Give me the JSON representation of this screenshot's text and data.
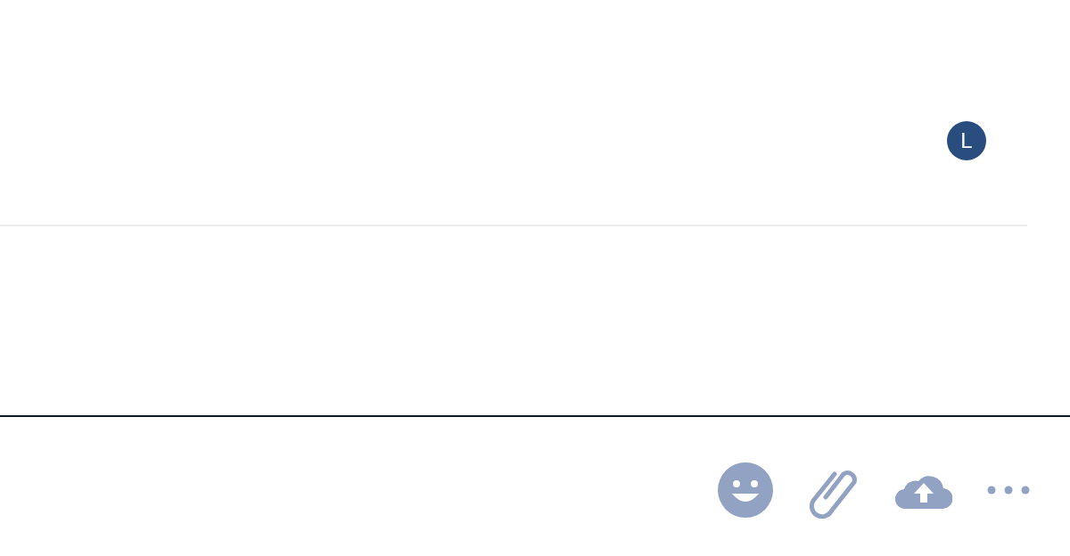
{
  "avatar": {
    "initial": "L"
  }
}
